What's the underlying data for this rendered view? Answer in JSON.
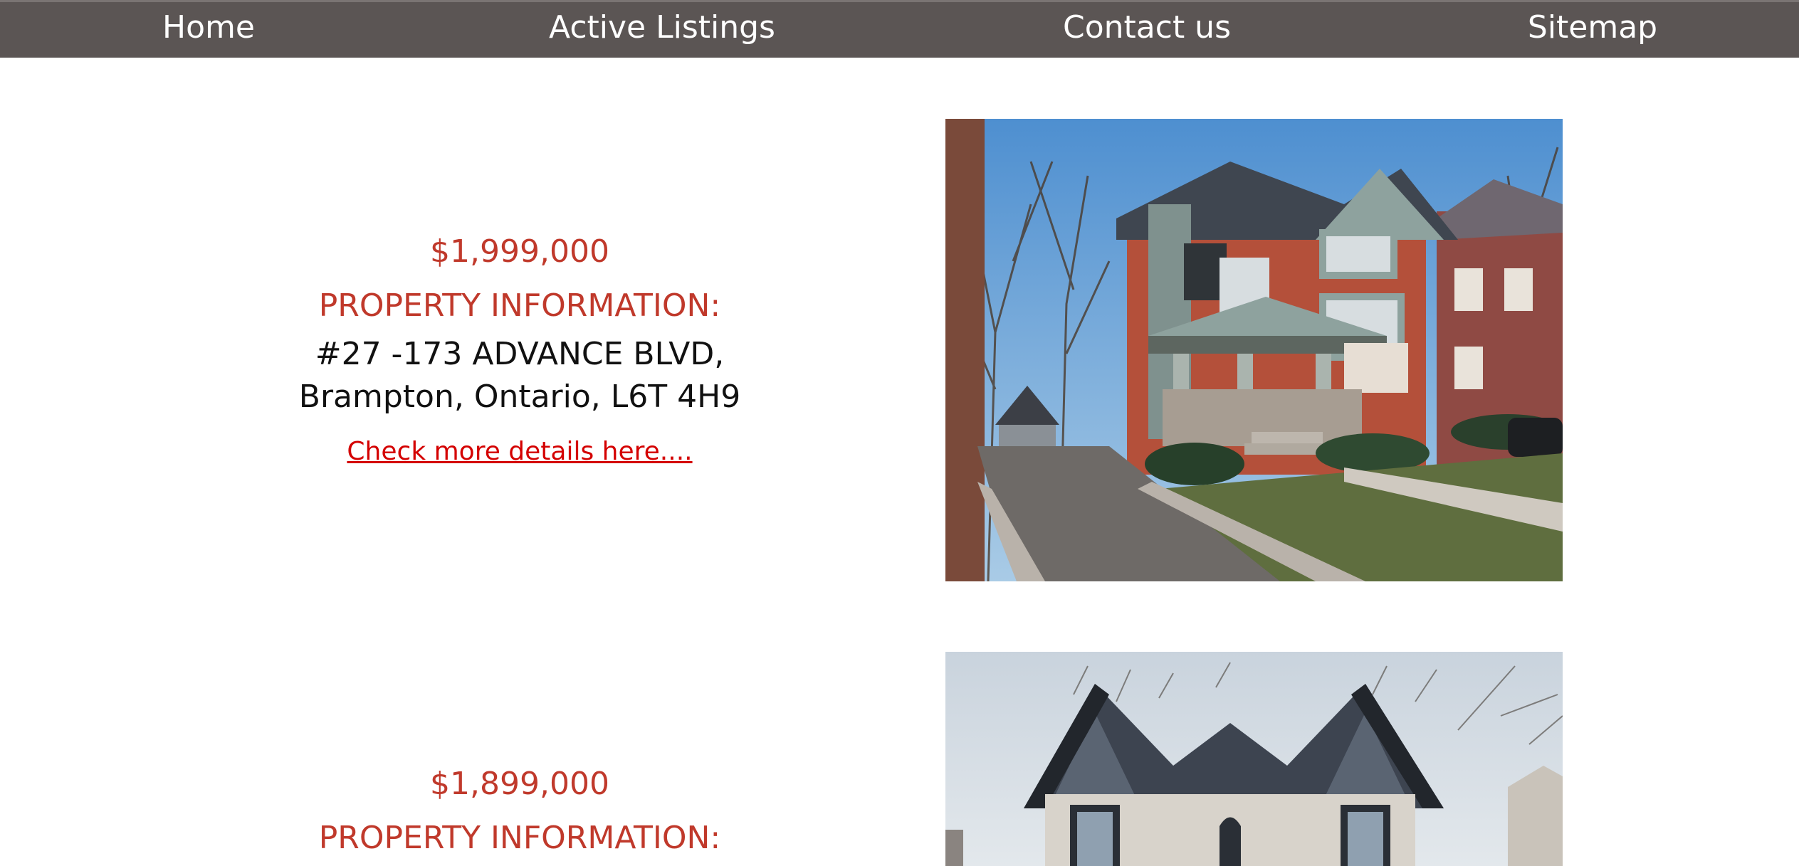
{
  "nav": {
    "items": [
      {
        "label": "Home"
      },
      {
        "label": "Active Listings"
      },
      {
        "label": "Contact us"
      },
      {
        "label": "Sitemap"
      }
    ]
  },
  "listings": [
    {
      "price": "$1,999,000",
      "heading": "PROPERTY INFORMATION:",
      "address": "#27 -173 ADVANCE BLVD, Brampton, Ontario, L6T 4H9",
      "link_text": "Check more details here....",
      "photo": "house-photo"
    },
    {
      "price": "$1,899,000",
      "heading": "PROPERTY INFORMATION:",
      "photo": "house-photo"
    }
  ],
  "colors": {
    "nav_bg": "#5b5554",
    "accent_red": "#c0392b",
    "link_red": "#d40000",
    "text": "#111111"
  }
}
